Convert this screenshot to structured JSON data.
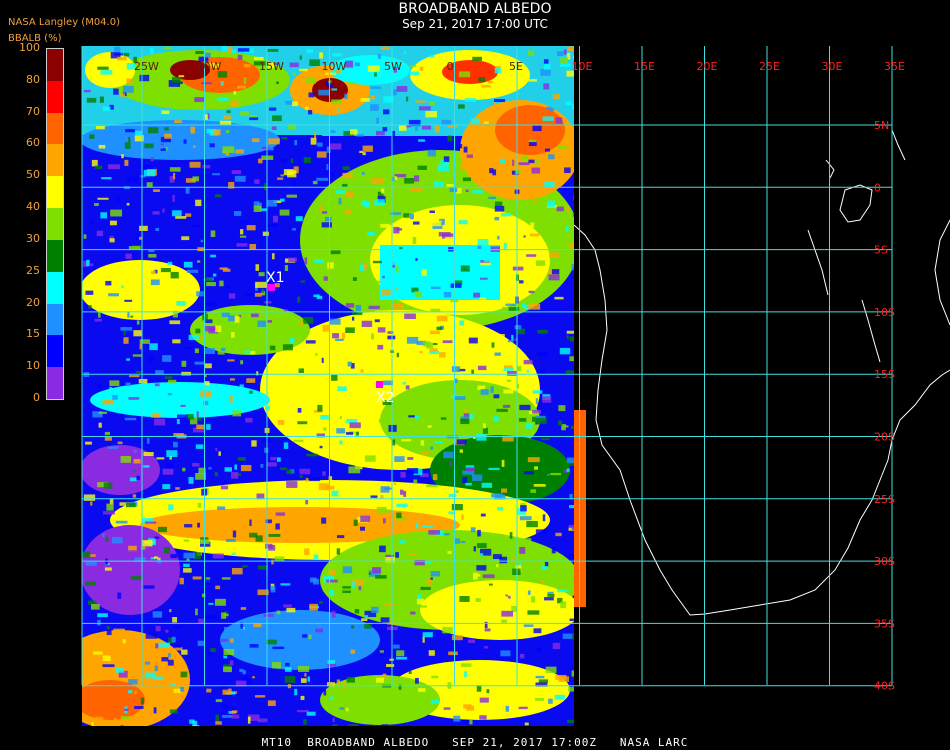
{
  "header": {
    "title": "BROADBAND ALBEDO",
    "subtitle": "Sep 21, 2017 17:00 UTC",
    "source": "NASA Langley (M04.0)",
    "variable": "BBALB (%)"
  },
  "legend": {
    "ticks": [
      "100",
      "80",
      "70",
      "60",
      "50",
      "40",
      "30",
      "25",
      "20",
      "15",
      "10",
      "0"
    ],
    "bands": [
      {
        "from": 80,
        "to": 100,
        "color": "#8b0000"
      },
      {
        "from": 70,
        "to": 80,
        "color": "#ff0000"
      },
      {
        "from": 60,
        "to": 70,
        "color": "#ff6400"
      },
      {
        "from": 50,
        "to": 60,
        "color": "#ffa500"
      },
      {
        "from": 40,
        "to": 50,
        "color": "#ffff00"
      },
      {
        "from": 30,
        "to": 40,
        "color": "#7fdf00"
      },
      {
        "from": 25,
        "to": 30,
        "color": "#008000"
      },
      {
        "from": 20,
        "to": 25,
        "color": "#00ffff"
      },
      {
        "from": 15,
        "to": 20,
        "color": "#1e90ff"
      },
      {
        "from": 10,
        "to": 15,
        "color": "#0000ff"
      },
      {
        "from": 0,
        "to": 10,
        "color": "#8a2be2"
      }
    ]
  },
  "map": {
    "lon_labels": [
      "25W",
      "20W",
      "15W",
      "10W",
      "5W",
      "0",
      "5E",
      "10E",
      "15E",
      "20E",
      "25E",
      "30E",
      "35E"
    ],
    "lat_labels": [
      "5N",
      "0",
      "5S",
      "10S",
      "15S",
      "20S",
      "25S",
      "30S",
      "35S",
      "40S"
    ],
    "grid_color": "#40e0e0",
    "label_color": "#ff2020",
    "markers": [
      {
        "label": "X1",
        "color": "#ff00ff"
      },
      {
        "label": "X2",
        "color": "#ff00ff"
      }
    ]
  },
  "footer": "MT10  BROADBAND ALBEDO   SEP 21, 2017 17:00Z   NASA LARC"
}
